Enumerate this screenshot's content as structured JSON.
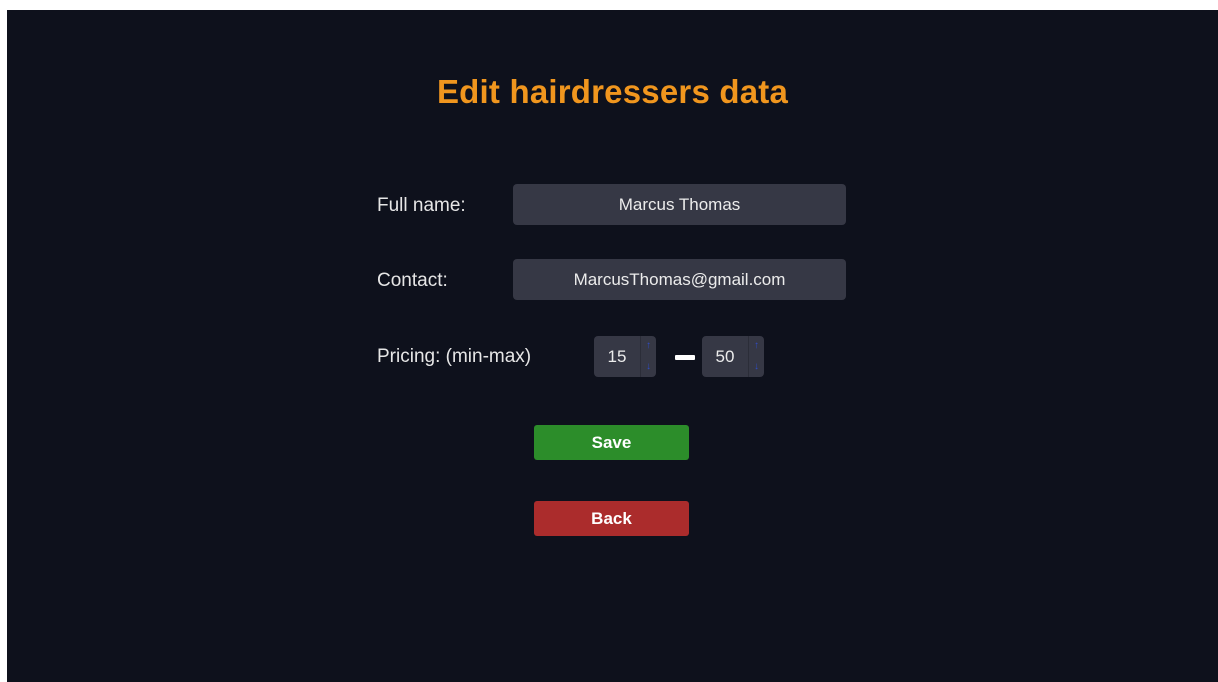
{
  "page": {
    "title": "Edit hairdressers data"
  },
  "form": {
    "full_name_label": "Full name:",
    "full_name_value": "Marcus Thomas",
    "contact_label": "Contact:",
    "contact_value": "MarcusThomas@gmail.com",
    "pricing_label": "Pricing: (min-max)",
    "pricing_min": "15",
    "pricing_max": "50",
    "spin_up_glyph": "↑",
    "spin_down_glyph": "↓"
  },
  "buttons": {
    "save_label": "Save",
    "back_label": "Back"
  },
  "colors": {
    "background": "#0e111c",
    "title": "#f0961e",
    "field": "#363845",
    "save": "#2c8d2a",
    "back": "#ab2c2c"
  },
  "icons": {
    "spin_up": "arrow-up-icon",
    "spin_down": "arrow-down-icon",
    "range_separator": "dash-separator"
  }
}
